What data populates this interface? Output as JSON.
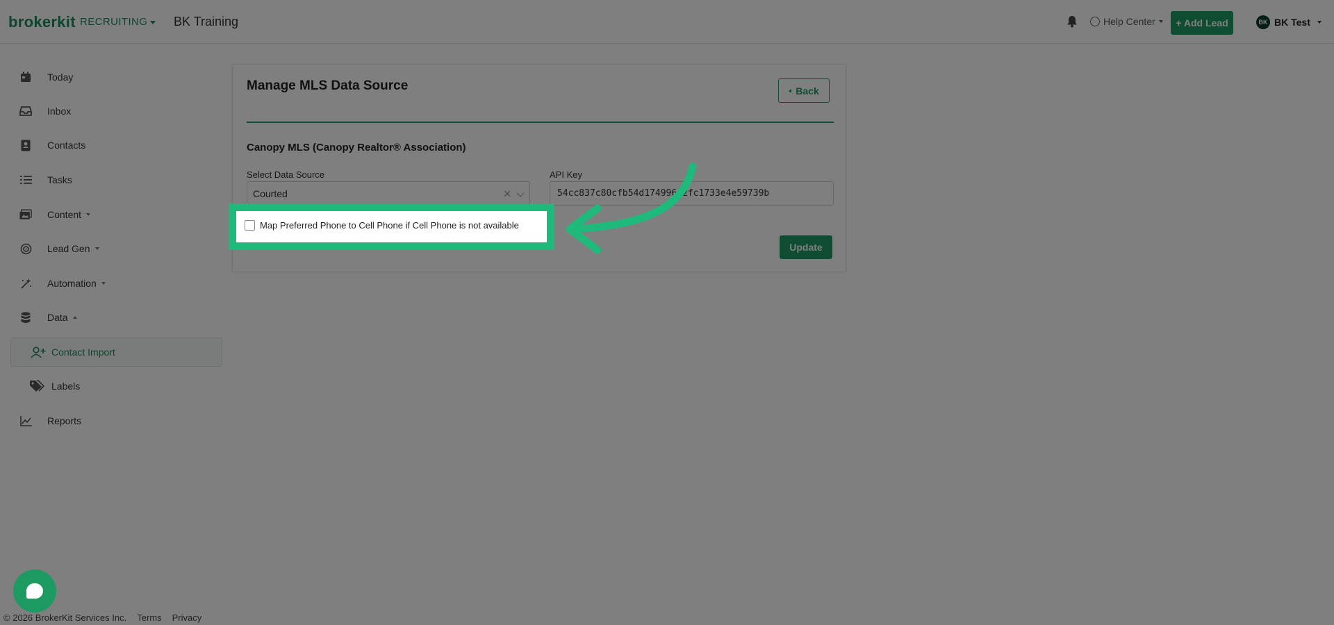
{
  "header": {
    "logo": "brokerkit",
    "product": "RECRUITING",
    "team_name": "BK Training",
    "help_center": "Help Center",
    "add_lead": "+ Add Lead",
    "user_initials": "BK",
    "user_name": "BK Test"
  },
  "sidebar": {
    "items": [
      {
        "label": "Today",
        "icon": "calendar-icon"
      },
      {
        "label": "Inbox",
        "icon": "inbox-icon"
      },
      {
        "label": "Contacts",
        "icon": "contacts-icon"
      },
      {
        "label": "Tasks",
        "icon": "tasks-icon"
      },
      {
        "label": "Content",
        "icon": "content-icon"
      },
      {
        "label": "Lead Gen",
        "icon": "lead-gen-icon"
      },
      {
        "label": "Automation",
        "icon": "automation-icon"
      },
      {
        "label": "Data",
        "icon": "database-icon"
      },
      {
        "label": "Contact Import",
        "icon": "user-plus-icon"
      },
      {
        "label": "Labels",
        "icon": "tags-icon"
      },
      {
        "label": "Reports",
        "icon": "chart-icon"
      }
    ]
  },
  "card": {
    "title": "Manage MLS Data Source",
    "back_label": "Back",
    "mls_name": "Canopy MLS (Canopy Realtor® Association)",
    "select_label": "Select Data Source",
    "select_value": "Courted",
    "api_label": "API Key",
    "api_value": "54cc837c80cfb54d174996e2fc1733e4e59739b",
    "checkbox_label": "Map Preferred Phone to Cell Phone if Cell Phone is not available",
    "update_label": "Update"
  },
  "footer": {
    "copyright": "© 2026 BrokerKit Services Inc.",
    "terms": "Terms",
    "privacy": "Privacy"
  },
  "colors": {
    "brand_green": "#1c9a62",
    "highlight_green": "#1dba7b"
  }
}
